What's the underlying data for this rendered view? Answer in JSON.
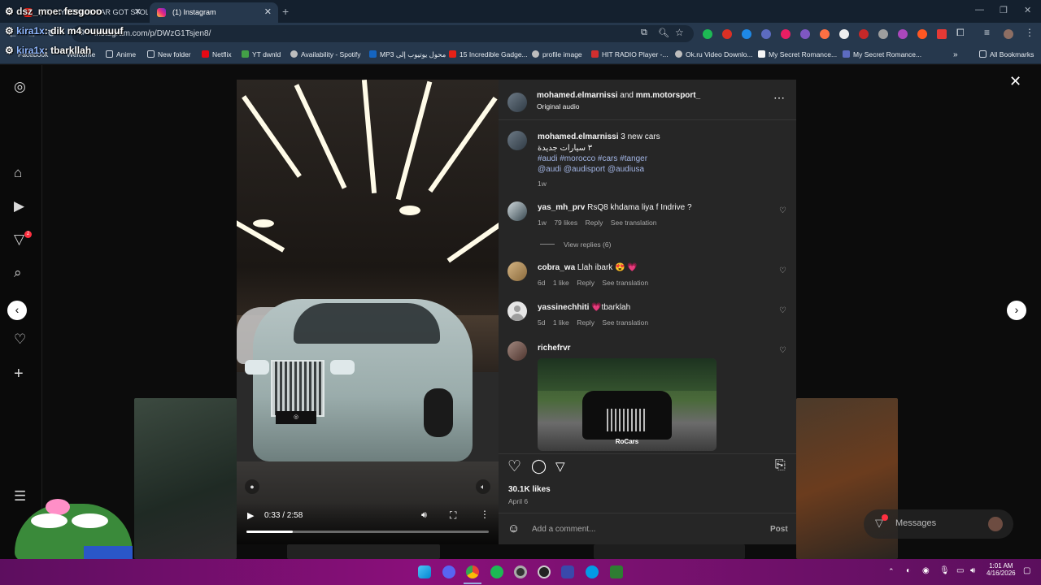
{
  "browser": {
    "tabs": [
      {
        "title": "(??) MY $20 MIL CAR GOT STOLEN",
        "active": false
      },
      {
        "title": "(1) Instagram",
        "active": true
      }
    ],
    "url": "instagram.com/p/DWzG1Tsjen8/",
    "bookmarks": [
      "Facebook",
      "Welcome",
      "Anime",
      "New folder",
      "Netflix",
      "YT dwnld",
      "Availability - Spotify",
      "MP3 محول يوتيوب إلى",
      "15 Incredible Gadge...",
      "profile image",
      "HIT RADIO Player -...",
      "Ok.ru Video Downlo...",
      "My Secret Romance...",
      "My Secret Romance..."
    ],
    "all_bookmarks": "All Bookmarks"
  },
  "chat_overlay": [
    {
      "user": "dsz_moe",
      "text": ": fesgooo"
    },
    {
      "user": "kira1x",
      "text": ": dik m4 ouuuuuf"
    },
    {
      "user": "kira1x",
      "text": ": tbarkllah"
    }
  ],
  "post": {
    "header": {
      "author": "mohamed.elmarnissi",
      "and": "and",
      "coauthor": "mm.motorsport_",
      "audio": "Original audio"
    },
    "caption": {
      "user": "mohamed.elmarnissi",
      "text": "3 new cars",
      "arabic": "٣ سيارات جديدة",
      "hashtags": "#audi #morocco #cars #tanger",
      "mentions": "@audi @audisport @audiusa",
      "time": "1w"
    },
    "comments": [
      {
        "user": "yas_mh_prv",
        "text": "RsQ8 khdama liya f Indrive ?",
        "time": "1w",
        "likes": "79 likes",
        "reply": "Reply",
        "translate": "See translation",
        "view_replies": "View replies (6)"
      },
      {
        "user": "cobra_wa",
        "text": "Llah ibark 😍 💗",
        "time": "6d",
        "likes": "1 like",
        "reply": "Reply",
        "translate": "See translation"
      },
      {
        "user": "yassinechhiti",
        "text": "💗tbarklah",
        "time": "5d",
        "likes": "1 like",
        "reply": "Reply",
        "translate": "See translation"
      },
      {
        "user": "richefrvr",
        "image_caption": "RoCars"
      }
    ],
    "likes": "30.1K likes",
    "date": "April 6",
    "add_comment_placeholder": "Add a comment...",
    "post_button": "Post",
    "video_time": "0:33 / 2:58",
    "video_progress": 0.19
  },
  "messages_label": "Messages",
  "notification_count": "2",
  "clock": {
    "time": "1:01 AM",
    "date": "4/16/2026"
  }
}
